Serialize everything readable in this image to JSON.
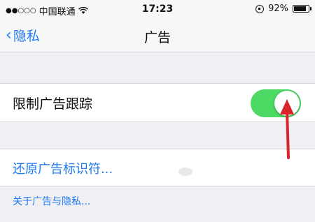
{
  "status_bar": {
    "signal_dots": "●●○○○",
    "carrier": "中国联通",
    "wifi_icon": "wifi-icon",
    "time": "17:23",
    "battery_percent": "92%",
    "battery_level": 0.92
  },
  "nav": {
    "back_label": "隐私",
    "title": "广告"
  },
  "settings": {
    "limit_ad_tracking_label": "限制广告跟踪",
    "limit_ad_tracking_on": true,
    "reset_ad_identifier_label": "还原广告标识符...",
    "about_link": "关于广告与隐私..."
  },
  "colors": {
    "accent": "#1f7bf2",
    "switch_on": "#4cd964",
    "annotation_arrow": "#d9252a"
  }
}
